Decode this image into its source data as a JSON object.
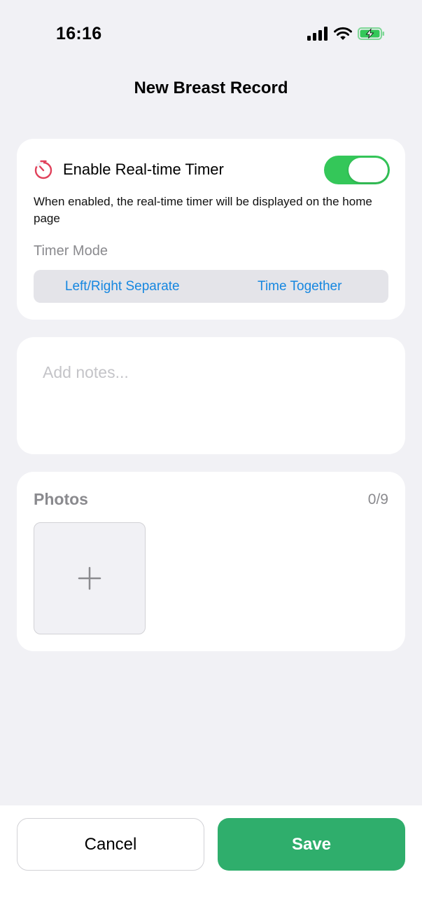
{
  "status_bar": {
    "time": "16:16"
  },
  "nav": {
    "title": "New Breast Record"
  },
  "timer_card": {
    "label": "Enable Real-time Timer",
    "enabled": true,
    "description": "When enabled, the real-time timer will be displayed on the home page",
    "mode_label": "Timer Mode",
    "modes": [
      "Left/Right Separate",
      "Time Together"
    ]
  },
  "notes": {
    "placeholder": "Add notes..."
  },
  "photos": {
    "title": "Photos",
    "count": "0/9"
  },
  "actions": {
    "cancel_label": "Cancel",
    "save_label": "Save"
  },
  "colors": {
    "accent_green": "#34c759",
    "save_green": "#2fae6c",
    "link_blue": "#1687e0",
    "timer_icon_red": "#e0405a"
  }
}
